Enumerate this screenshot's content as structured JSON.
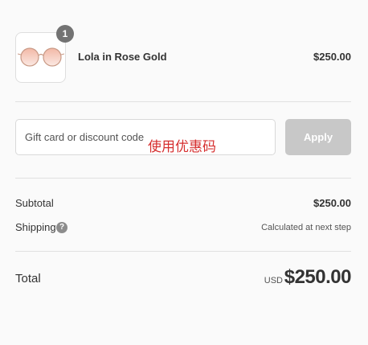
{
  "order": {
    "quantity": "1",
    "product_name": "Lola in Rose Gold",
    "product_price": "$250.00",
    "product_image_icon": "glasses-icon"
  },
  "discount": {
    "placeholder": "Gift card or discount code",
    "annotation": "使用优惠码",
    "apply_label": "Apply"
  },
  "summary": {
    "subtotal_label": "Subtotal",
    "subtotal_value": "$250.00",
    "shipping_label": "Shipping",
    "shipping_help_icon": "question-icon",
    "shipping_help_glyph": "?",
    "shipping_value": "Calculated at next step"
  },
  "total": {
    "label": "Total",
    "currency": "USD",
    "amount": "$250.00"
  },
  "colors": {
    "background": "#fafafa",
    "text": "#333333",
    "annotation_red": "#d62f2f",
    "disabled_button": "#c8c8c8",
    "badge": "#737373",
    "lens_tint": "#f2c3b3",
    "frame_gold": "#c99a86"
  }
}
